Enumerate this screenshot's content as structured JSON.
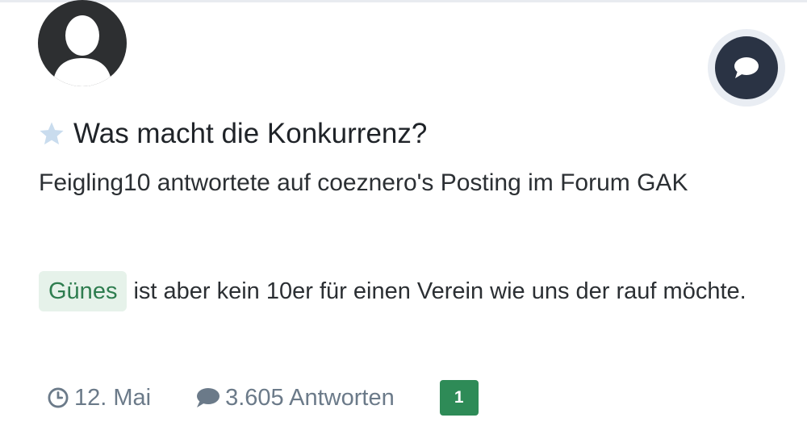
{
  "colors": {
    "accent_green": "#2e8b57",
    "tag_background": "#e6f2ea",
    "tag_text": "#2e7d4f",
    "meta_text": "#6b7a89",
    "fab_background": "#2a3344",
    "star": "#c9dcee"
  },
  "icons": {
    "avatar": "user-silhouette-icon",
    "fab": "chat-bubble-icon",
    "title": "star-icon",
    "date": "clock-icon",
    "replies": "comment-icon"
  },
  "post": {
    "title": "Was macht die Konkurrenz?",
    "subtitle": "Feigling10 antwortete auf coeznero's Posting im Forum GAK",
    "tag": "Günes",
    "body": "ist aber kein 10er für einen Verein wie uns der rauf möchte."
  },
  "meta": {
    "date": "12. Mai",
    "replies": "3.605 Antworten",
    "unread_count": "1"
  }
}
